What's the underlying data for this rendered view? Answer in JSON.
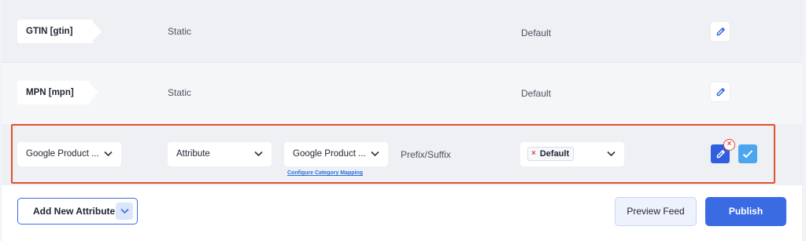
{
  "rows": [
    {
      "attribute": "GTIN [gtin]",
      "type": "Static",
      "output": "Default"
    },
    {
      "attribute": "MPN [mpn]",
      "type": "Static",
      "output": "Default"
    }
  ],
  "edit_row": {
    "attribute_select": "Google Product ...",
    "type_select": "Attribute",
    "value_select": "Google Product ...",
    "configure_link": "Configure Category Mapping",
    "prefix_suffix": "Prefix/Suffix",
    "output_chip": "Default",
    "chip_remove": "×",
    "close_badge": "×"
  },
  "footer": {
    "add_attribute": "Add New Attribute",
    "preview": "Preview Feed",
    "publish": "Publish"
  },
  "colors": {
    "accent": "#3a6be3",
    "highlight": "#e0512f",
    "confirm": "#4aa6ee",
    "danger": "#e0453a"
  },
  "icons": [
    "pencil-icon",
    "chevron-down-icon",
    "close-icon",
    "check-icon"
  ]
}
